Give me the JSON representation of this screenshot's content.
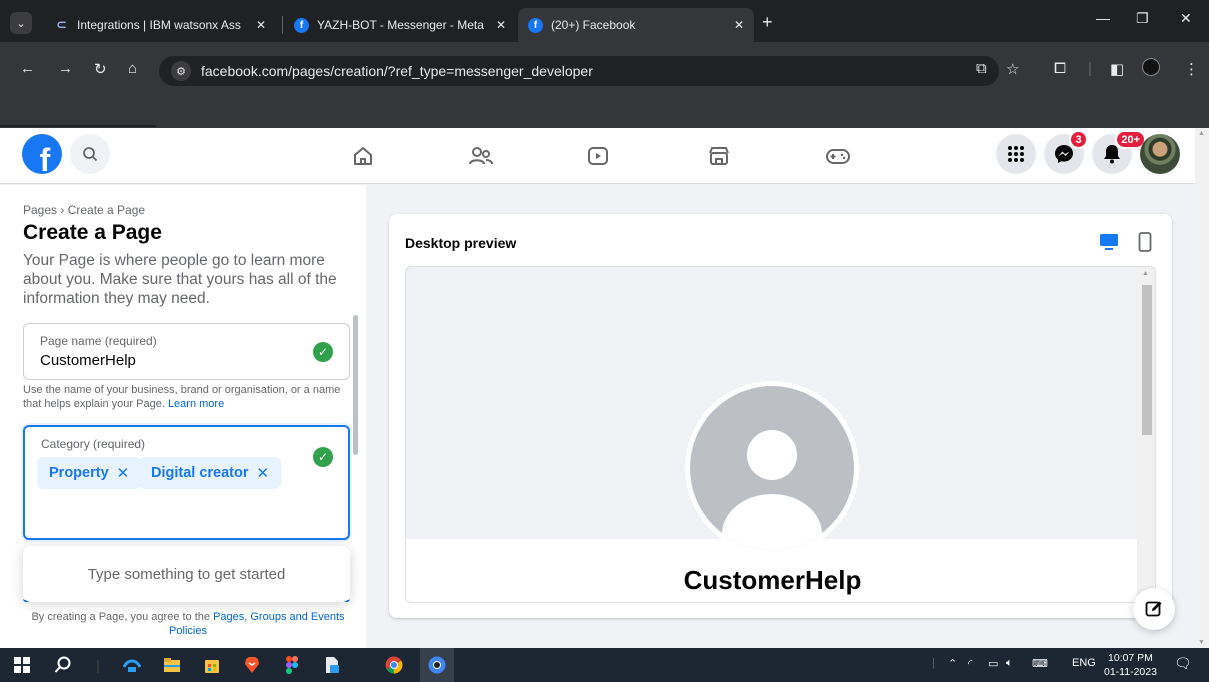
{
  "browser": {
    "tabs": [
      {
        "title": "Integrations | IBM watsonx Ass",
        "icon": "ibm-icon",
        "active": false
      },
      {
        "title": "YAZH-BOT - Messenger - Meta",
        "icon": "facebook-icon",
        "active": false
      },
      {
        "title": "(20+) Facebook",
        "icon": "facebook-icon",
        "active": true
      }
    ],
    "url": "facebook.com/pages/creation/?ref_type=messenger_developer"
  },
  "fbnav": {
    "messenger_badge": "3",
    "notifications_badge": "20+"
  },
  "left_panel": {
    "breadcrumb": "Pages › Create a Page",
    "title": "Create a Page",
    "description": "Your Page is where people go to learn more about you. Make sure that yours has all of the information they may need.",
    "page_name_label": "Page name (required)",
    "page_name_value": "CustomerHelp",
    "page_name_help": "Use the name of your business, brand or organisation, or a name that helps explain your Page.",
    "learn_more": "Learn more",
    "category_label": "Category (required)",
    "categories": [
      "Property",
      "Digital creator"
    ],
    "dropdown_hint": "Type something to get started",
    "terms_prefix": "By creating a Page, you agree to the",
    "terms_link": "Pages, Groups and Events Policies"
  },
  "preview": {
    "title": "Desktop preview",
    "page_name": "CustomerHelp"
  },
  "taskbar": {
    "language": "ENG",
    "time": "10:07 PM",
    "date": "01-11-2023"
  },
  "colors": {
    "fb_blue": "#1877f2",
    "check_green": "#31a24c",
    "badge_red": "#e41e3f"
  }
}
